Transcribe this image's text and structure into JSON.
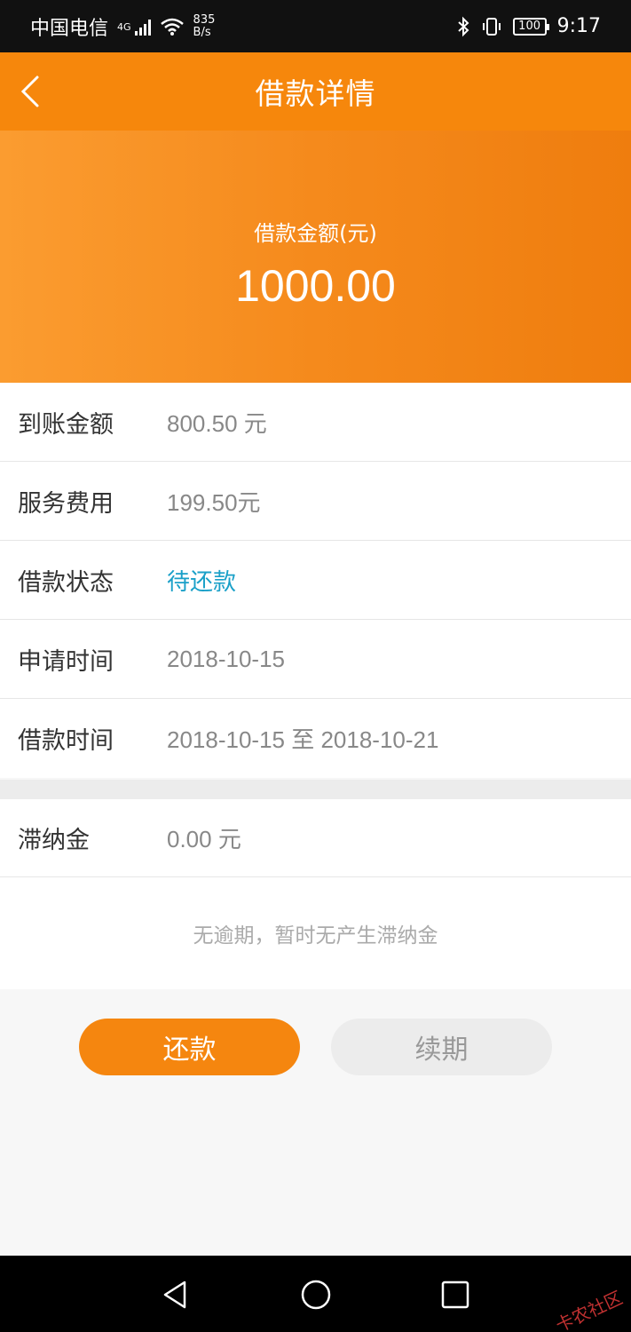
{
  "status_bar": {
    "carrier": "中国电信",
    "network_type": "4G",
    "net_speed_value": "835",
    "net_speed_unit": "B/s",
    "battery": "100",
    "time": "9:17"
  },
  "nav": {
    "title": "借款详情",
    "back_icon": "chevron-left-icon"
  },
  "hero": {
    "label": "借款金额(元)",
    "amount": "1000.00"
  },
  "details": [
    {
      "label": "到账金额",
      "value": "800.50 元"
    },
    {
      "label": "服务费用",
      "value": "199.50元"
    },
    {
      "label": "借款状态",
      "value": "待还款"
    },
    {
      "label": "申请时间",
      "value": "2018-10-15"
    },
    {
      "label": "借款时间",
      "value": "2018-10-15 至 2018-10-21"
    }
  ],
  "late_fee": {
    "label": "滞纳金",
    "value": "0.00 元",
    "note": "无逾期，暂时无产生滞纳金"
  },
  "actions": {
    "repay_label": "还款",
    "extend_label": "续期"
  },
  "colors": {
    "brand_orange": "#f6870c",
    "status_blue": "#1aa0c8"
  },
  "watermark": "卡农社区"
}
